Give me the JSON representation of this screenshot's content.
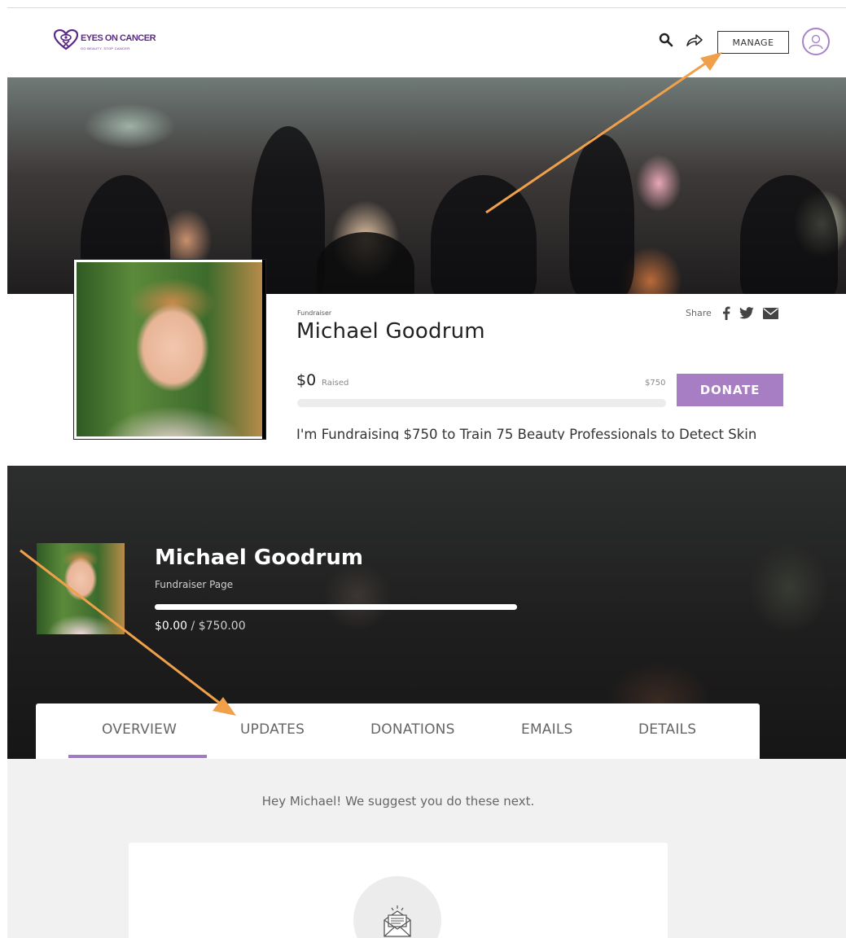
{
  "header": {
    "logo_text": "EYES ON CANCER",
    "logo_sub": "GO BEAUTY. STOP CANCER.",
    "manage_label": "MANAGE"
  },
  "fundraiser": {
    "label": "Fundraiser",
    "name": "Michael Goodrum",
    "share_label": "Share",
    "raised_amount": "$0",
    "raised_label": "Raised",
    "goal_label": "$750",
    "progress_fraction": 0,
    "donate_label": "DONATE",
    "description": "I'm Fundraising $750 to Train 75 Beauty Professionals to Detect Skin"
  },
  "dashboard": {
    "name": "Michael Goodrum",
    "subtitle": "Fundraiser Page",
    "progress_fraction": 1.0,
    "amount_raised": "$0.00",
    "amount_sep": " / ",
    "amount_goal": "$750.00",
    "tabs": [
      {
        "label": "OVERVIEW",
        "active": true
      },
      {
        "label": "UPDATES",
        "active": false
      },
      {
        "label": "DONATIONS",
        "active": false
      },
      {
        "label": "EMAILS",
        "active": false
      },
      {
        "label": "DETAILS",
        "active": false
      }
    ],
    "suggestion": "Hey Michael! We suggest you do these next."
  },
  "colors": {
    "brand_purple": "#5b2a82",
    "accent_purple": "#a77ec3",
    "annotation_arrow": "#f0a04b"
  },
  "icons": {
    "search": "search-icon",
    "share": "share-arrow-icon",
    "user": "user-avatar-icon",
    "facebook": "facebook-icon",
    "twitter": "twitter-icon",
    "email": "email-icon",
    "envelope": "envelope-icon"
  }
}
